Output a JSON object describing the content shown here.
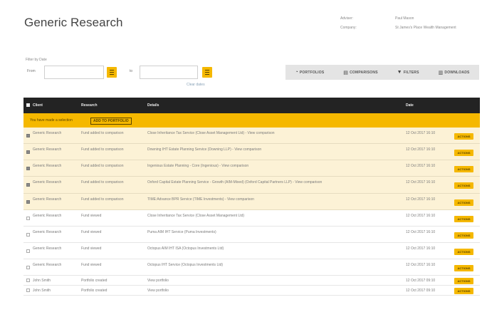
{
  "page": {
    "title": "Generic Research"
  },
  "meta": {
    "adviser_label": "Adviser:",
    "adviser_value": "Paul Mason",
    "company_label": "Company:",
    "company_value": "St James's Place Wealth Management"
  },
  "filter": {
    "caption": "Filter by Date",
    "from_label": "From",
    "to_label": "to",
    "from_value": "",
    "to_value": "",
    "clear_label": "Clear dates"
  },
  "toolbar": {
    "portfolios": "PORTFOLIOS",
    "comparisons": "COMPARISONS",
    "filters": "FILTERS",
    "downloads": "DOWNLOADS",
    "icons": {
      "portfolios": "pie-chart-icon",
      "comparisons": "comparison-icon",
      "filters": "filter-icon",
      "downloads": "download-icon"
    }
  },
  "table": {
    "headers": {
      "client": "Client",
      "research": "Research",
      "details": "Details",
      "date": "Date"
    },
    "bulk_message": "You have made a selection",
    "bulk_button": "ADD TO PORTFOLIO",
    "rows": [
      {
        "selected": true,
        "client": "Generic Research",
        "research": "Fund added to comparison",
        "details": "Close Inheritance Tax Service (Close Asset Management Ltd) - View comparison",
        "date": "12 Oct 2017 16:10",
        "action": "ACTIONS"
      },
      {
        "selected": true,
        "client": "Generic Research",
        "research": "Fund added to comparison",
        "details": "Downing IHT Estate Planning Service (Downing LLP) - View comparison",
        "date": "12 Oct 2017 16:10",
        "action": "ACTIONS"
      },
      {
        "selected": true,
        "client": "Generic Research",
        "research": "Fund added to comparison",
        "details": "Ingenious Estate Planning - Core (Ingenious) - View comparison",
        "date": "12 Oct 2017 16:10",
        "action": "ACTIONS"
      },
      {
        "selected": true,
        "client": "Generic Research",
        "research": "Fund added to comparison",
        "details": "Oxford Capital Estate Planning Service - Growth (AIM-Mixed) (Oxford Capital Partners LLP) - View comparison",
        "date": "12 Oct 2017 16:10",
        "action": "ACTIONS"
      },
      {
        "selected": true,
        "client": "Generic Research",
        "research": "Fund added to comparison",
        "details": "TIME:Advance BPR Service (TIME Investments) - View comparison",
        "date": "12 Oct 2017 16:10",
        "action": "ACTIONS"
      },
      {
        "selected": false,
        "client": "Generic Research",
        "research": "Fund viewed",
        "details": "Close Inheritance Tax Service (Close Asset Management Ltd)",
        "date": "12 Oct 2017 16:10",
        "action": "ACTIONS"
      },
      {
        "selected": false,
        "client": "Generic Research",
        "research": "Fund viewed",
        "details": "Puma AIM IHT Service (Puma Investments)",
        "date": "12 Oct 2017 16:10",
        "action": "ACTIONS"
      },
      {
        "selected": false,
        "client": "Generic Research",
        "research": "Fund viewed",
        "details": "Octopus AIM IHT ISA (Octopus Investments Ltd)",
        "date": "12 Oct 2017 16:10",
        "action": "ACTIONS"
      },
      {
        "selected": false,
        "client": "Generic Research",
        "research": "Fund viewed",
        "details": "Octopus IHT Service (Octopus Investments Ltd)",
        "date": "12 Oct 2017 16:10",
        "action": "ACTIONS"
      },
      {
        "selected": false,
        "client": "John Smith",
        "research": "Portfolio created",
        "details": "View portfolio",
        "date": "12 Oct 2017 09:10",
        "action": "ACTIONS"
      },
      {
        "selected": false,
        "client": "John Smith",
        "research": "Portfolio created",
        "details": "View portfolio",
        "date": "12 Oct 2017 09:10",
        "action": "ACTIONS"
      }
    ]
  },
  "colors": {
    "accent": "#f5b800",
    "header_bg": "#232323",
    "selected_row": "#fcf2d6"
  }
}
